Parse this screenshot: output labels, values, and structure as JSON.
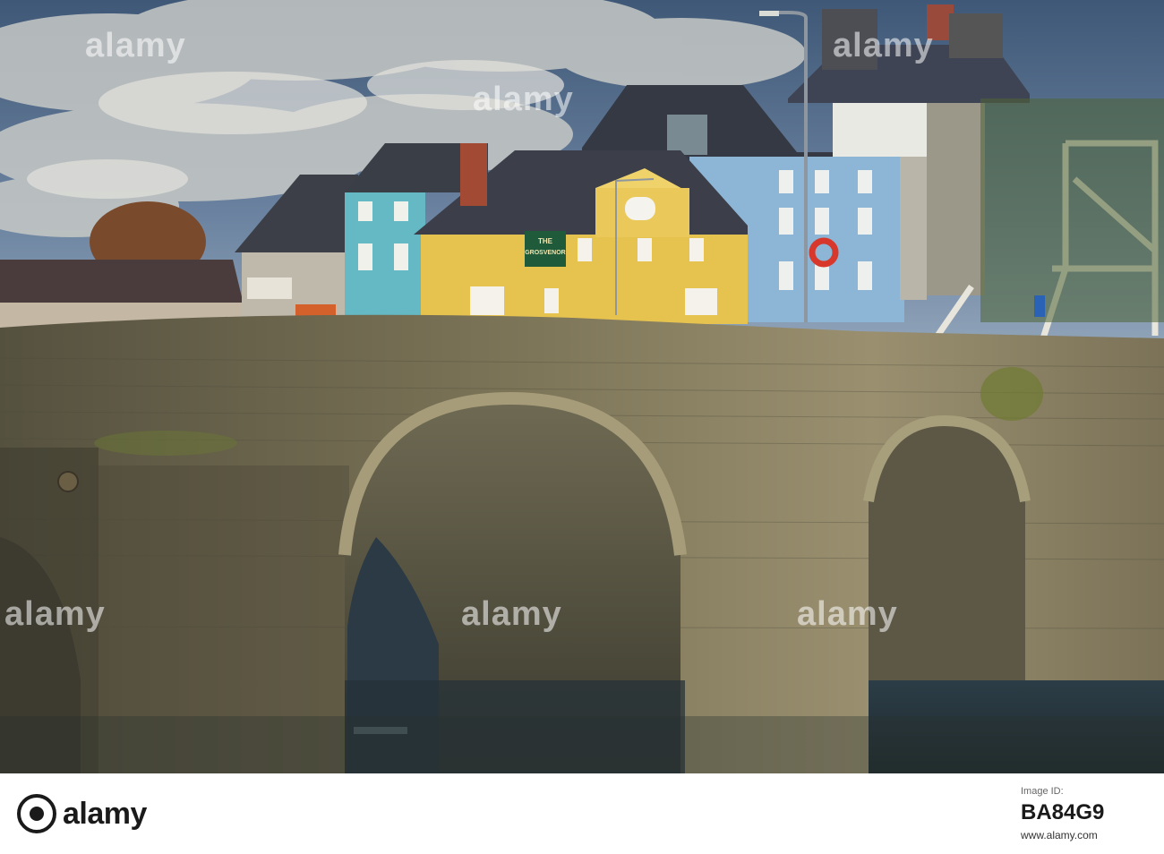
{
  "photo": {
    "sign_line1": "THE",
    "sign_line2": "GROSVENOR",
    "colors": {
      "sky": "#4f6b8a",
      "cloud": "#c9cbc8",
      "stone": "#6f6a55",
      "stone_lit": "#948b6c",
      "water": "#2d3a3e",
      "house_yellow": "#e7c44e",
      "house_blue": "#8fb6d6",
      "house_teal": "#5fb8c4",
      "roof": "#3d4049"
    }
  },
  "watermarks": {
    "text": "alamy"
  },
  "footer": {
    "brand": "alamy",
    "image_id_label": "Image ID:",
    "image_id": "BA84G9",
    "site": "www.alamy.com"
  }
}
